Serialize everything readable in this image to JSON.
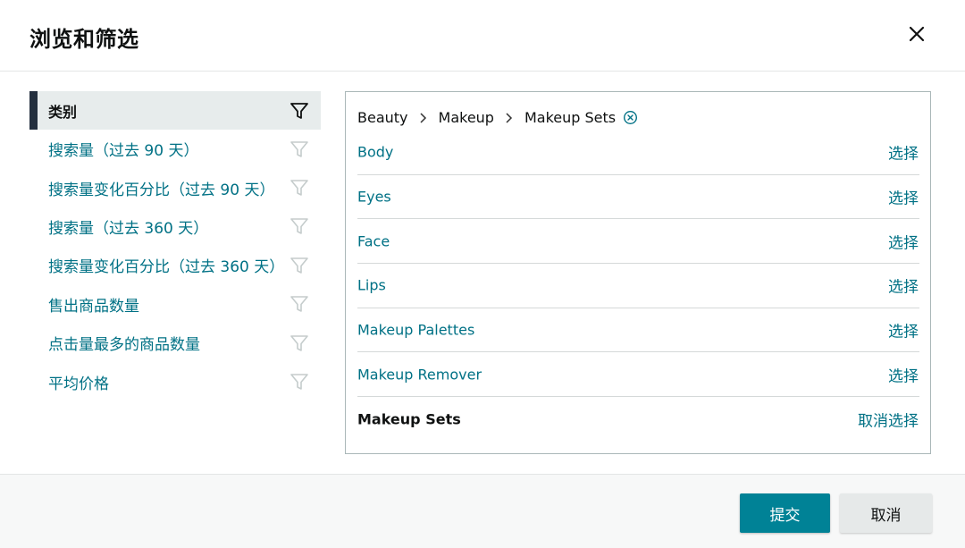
{
  "dialog": {
    "title": "浏览和筛选",
    "close_icon": "close-icon"
  },
  "sidebar": {
    "items": [
      {
        "label": "类别",
        "active": true,
        "icon": "filter-icon"
      },
      {
        "label": "搜索量（过去 90 天）",
        "active": false,
        "icon": "filter-icon"
      },
      {
        "label": "搜索量变化百分比（过去 90 天）",
        "active": false,
        "icon": "filter-icon"
      },
      {
        "label": "搜索量（过去 360 天）",
        "active": false,
        "icon": "filter-icon"
      },
      {
        "label": "搜索量变化百分比（过去 360 天）",
        "active": false,
        "icon": "filter-icon"
      },
      {
        "label": "售出商品数量",
        "active": false,
        "icon": "filter-icon"
      },
      {
        "label": "点击量最多的商品数量",
        "active": false,
        "icon": "filter-icon"
      },
      {
        "label": "平均价格",
        "active": false,
        "icon": "filter-icon"
      }
    ]
  },
  "breadcrumb": {
    "items": [
      "Beauty",
      "Makeup",
      "Makeup Sets"
    ],
    "clear_icon": "clear-circle-icon"
  },
  "categories": {
    "rows": [
      {
        "label": "Body",
        "action": "选择",
        "selected": false
      },
      {
        "label": "Eyes",
        "action": "选择",
        "selected": false
      },
      {
        "label": "Face",
        "action": "选择",
        "selected": false
      },
      {
        "label": "Lips",
        "action": "选择",
        "selected": false
      },
      {
        "label": "Makeup Palettes",
        "action": "选择",
        "selected": false
      },
      {
        "label": "Makeup Remover",
        "action": "选择",
        "selected": false
      },
      {
        "label": "Makeup Sets",
        "action": "取消选择",
        "selected": true
      }
    ]
  },
  "footer": {
    "submit_label": "提交",
    "cancel_label": "取消"
  },
  "colors": {
    "accent": "#008296",
    "link": "#007185",
    "active_bar": "#232f3e"
  }
}
